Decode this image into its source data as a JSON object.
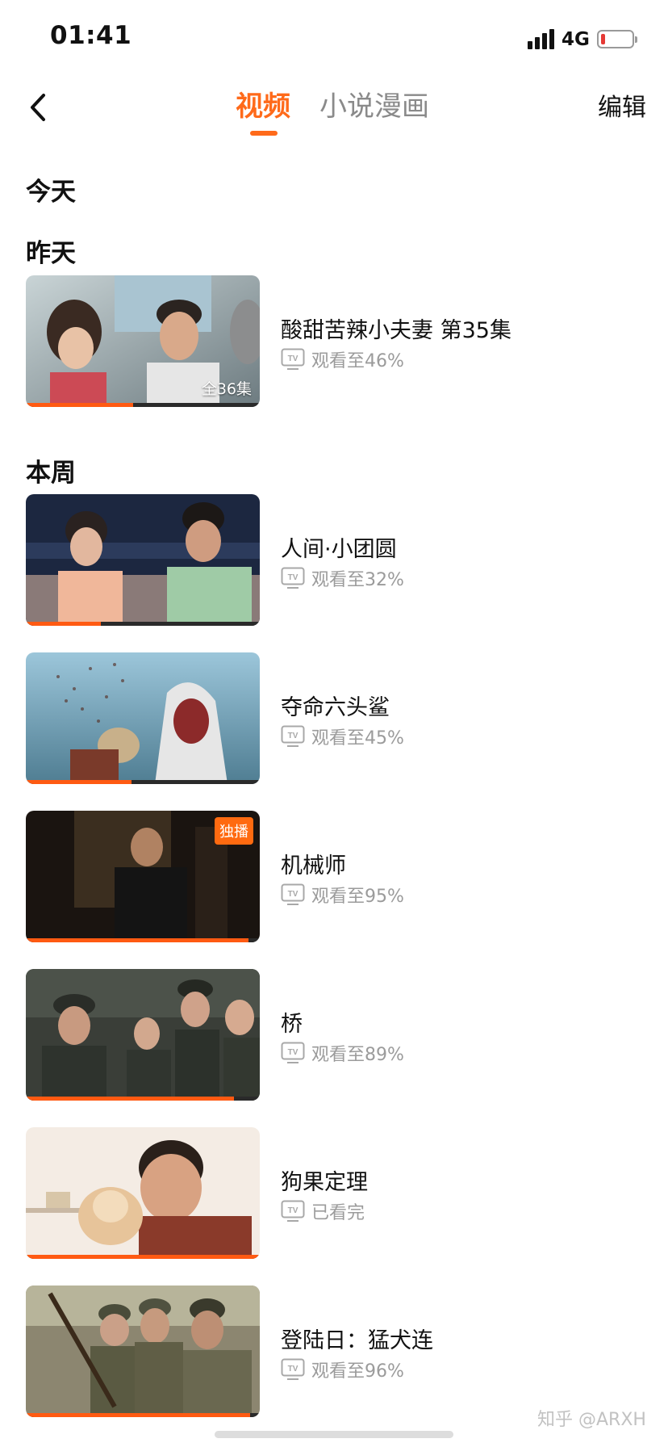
{
  "status_bar": {
    "time": "01:41",
    "network": "4G",
    "battery_color": "#e53935"
  },
  "header": {
    "tabs": [
      {
        "label": "视频",
        "active": true
      },
      {
        "label": "小说漫画",
        "active": false
      }
    ],
    "edit_label": "编辑",
    "accent_color": "#ff6a1a"
  },
  "sections": {
    "today": "今天",
    "yesterday": "昨天",
    "this_week": "本周"
  },
  "items": [
    {
      "title": "酸甜苦辣小夫妻 第35集",
      "progress_text": "观看至46%",
      "progress": 0.46,
      "episode_badge": "全36集"
    },
    {
      "title": "人间·小团圆",
      "progress_text": "观看至32%",
      "progress": 0.32
    },
    {
      "title": "夺命六头鲨",
      "progress_text": "观看至45%",
      "progress": 0.45
    },
    {
      "title": "机械师",
      "progress_text": "观看至95%",
      "progress": 0.95,
      "exclusive_badge": "独播"
    },
    {
      "title": "桥",
      "progress_text": "观看至89%",
      "progress": 0.89
    },
    {
      "title": "狗果定理",
      "progress_text": "已看完",
      "progress": 1.0
    },
    {
      "title": "登陆日：猛犬连",
      "progress_text": "观看至96%",
      "progress": 0.96
    }
  ],
  "watermark": "知乎 @ARXH"
}
